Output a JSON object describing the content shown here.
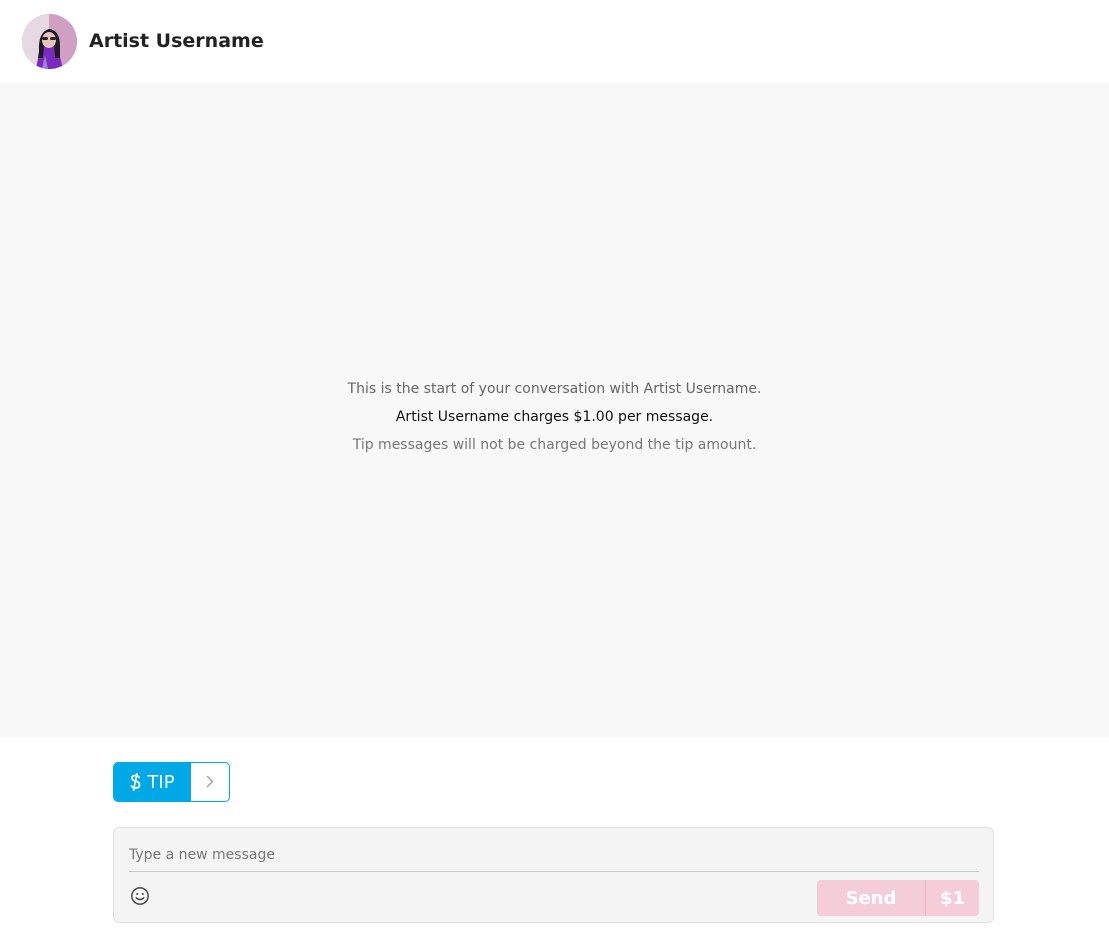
{
  "header": {
    "title": "Artist Username",
    "avatar_icon": "user-avatar-photo"
  },
  "conversation": {
    "intro_line_1": "This is the start of your conversation with Artist Username.",
    "intro_line_2": "Artist Username charges $1.00 per message.",
    "intro_line_3": "Tip messages will not be charged beyond the tip amount."
  },
  "tip": {
    "label": "TIP",
    "icon": "dollar-icon",
    "expand_icon": "chevron-right-icon"
  },
  "composer": {
    "placeholder": "Type a new message",
    "value": "",
    "emoji_icon": "smiley-icon",
    "send_label": "Send",
    "price_label": "$1"
  },
  "colors": {
    "accent_blue": "#00a9e6",
    "send_disabled_pink": "#f5cdd9",
    "conversation_bg": "#f8f8f8"
  }
}
